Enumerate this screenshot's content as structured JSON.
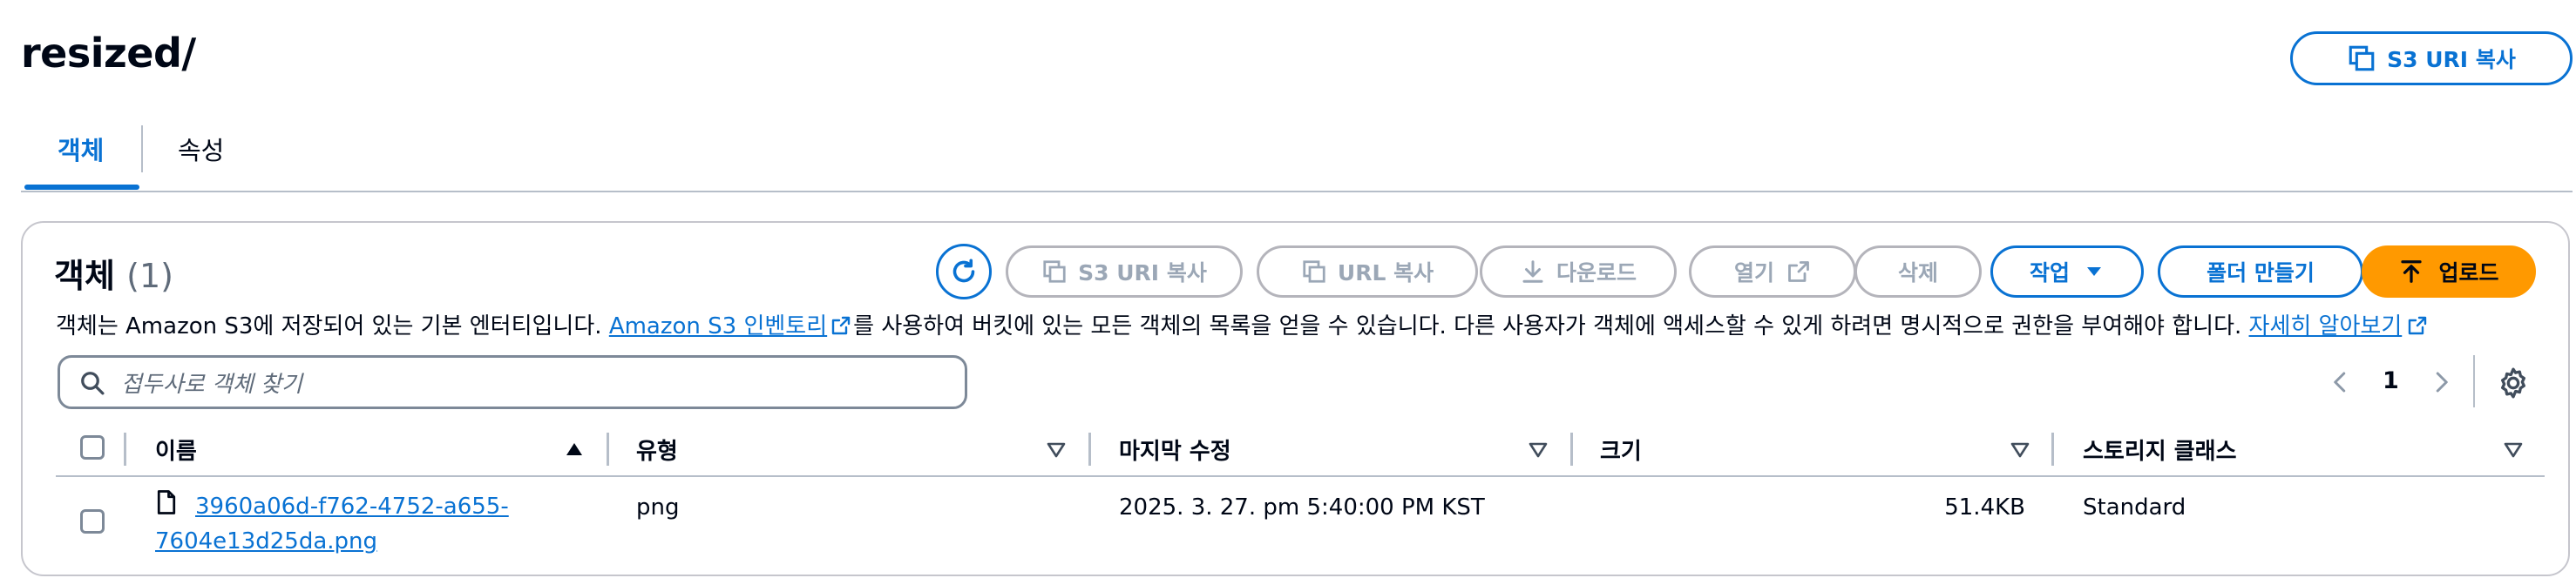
{
  "page": {
    "title": "resized/",
    "copy_s3_uri_label": "S3 URI 복사"
  },
  "tabs": [
    {
      "label": "객체",
      "active": true
    },
    {
      "label": "속성",
      "active": false
    }
  ],
  "objects": {
    "heading": "객체",
    "count": "(1)",
    "actions": {
      "copy_s3_uri": "S3 URI 복사",
      "copy_url": "URL 복사",
      "download": "다운로드",
      "open": "열기",
      "delete": "삭제",
      "actions_menu": "작업",
      "create_folder": "폴더 만들기",
      "upload": "업로드"
    },
    "description": {
      "part1": "객체는 Amazon S3에 저장되어 있는 기본 엔터티입니다. ",
      "link1": "Amazon S3 인벤토리",
      "part2": "를 사용하여 버킷에 있는 모든 객체의 목록을 얻을 수 있습니다. 다른 사용자가 객체에 액세스할 수 있게 하려면 명시적으로 권한을 부여해야 합니다. ",
      "link2": "자세히 알아보기"
    },
    "search_placeholder": "접두사로 객체 찾기",
    "pagination": {
      "current_page": "1"
    },
    "table": {
      "columns": [
        "이름",
        "유형",
        "마지막 수정",
        "크기",
        "스토리지 클래스"
      ],
      "rows": [
        {
          "name_line1": "3960a06d-f762-4752-a655-",
          "name_line2": "7604e13d25da.png",
          "type": "png",
          "last_modified": "2025. 3. 27. pm 5:40:00 PM KST",
          "size": "51.4KB",
          "storage_class": "Standard"
        }
      ]
    }
  },
  "colors": {
    "accent": "#0972d3",
    "primary_button": "#ff9900",
    "disabled": "#9ba7b6",
    "border": "#c6c6cd"
  },
  "icons": [
    "copy-icon",
    "refresh-icon",
    "download-icon",
    "external-link-icon",
    "caret-down-icon",
    "upload-arrow-icon",
    "search-icon",
    "chevron-left-icon",
    "chevron-right-icon",
    "settings-gear-icon",
    "file-icon",
    "sort-ascending-icon",
    "sort-descending-icon"
  ]
}
